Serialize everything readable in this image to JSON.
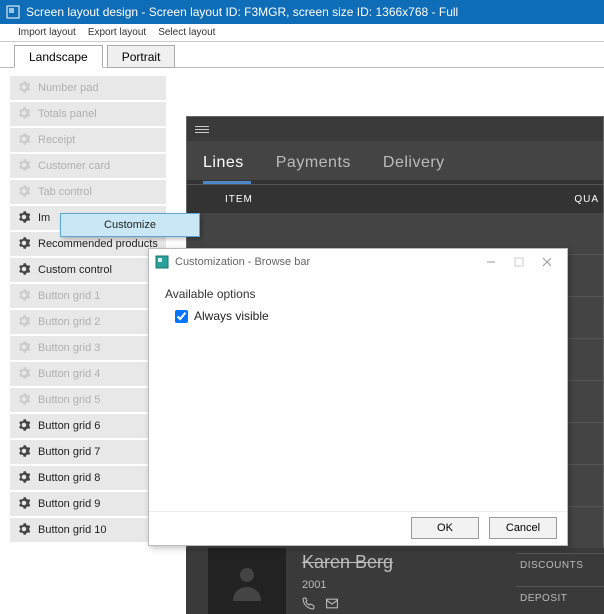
{
  "title": "Screen layout design - Screen layout ID: F3MGR, screen size ID: 1366x768 - Full",
  "menubar": [
    "Import layout",
    "Export layout",
    "Select layout"
  ],
  "tabs": {
    "landscape": "Landscape",
    "portrait": "Portrait"
  },
  "sidebar": {
    "items": [
      {
        "label": "Number pad",
        "enabled": false
      },
      {
        "label": "Totals panel",
        "enabled": false
      },
      {
        "label": "Receipt",
        "enabled": false
      },
      {
        "label": "Customer card",
        "enabled": false
      },
      {
        "label": "Tab control",
        "enabled": false
      },
      {
        "label": "Im",
        "enabled": true
      },
      {
        "label": "Recommended products",
        "enabled": true
      },
      {
        "label": "Custom control",
        "enabled": true
      },
      {
        "label": "Button grid 1",
        "enabled": false
      },
      {
        "label": "Button grid 2",
        "enabled": false
      },
      {
        "label": "Button grid 3",
        "enabled": false
      },
      {
        "label": "Button grid 4",
        "enabled": false
      },
      {
        "label": "Button grid 5",
        "enabled": false
      },
      {
        "label": "Button grid 6",
        "enabled": true
      },
      {
        "label": "Button grid 7",
        "enabled": true
      },
      {
        "label": "Button grid 8",
        "enabled": true
      },
      {
        "label": "Button grid 9",
        "enabled": true
      },
      {
        "label": "Button grid 10",
        "enabled": true
      }
    ]
  },
  "context_menu": {
    "item": "Customize"
  },
  "preview": {
    "tabs": {
      "lines": "Lines",
      "payments": "Payments",
      "delivery": "Delivery"
    },
    "header": {
      "item": "ITEM",
      "quantity": "QUA"
    },
    "user": {
      "name": "Karen Berg",
      "year": "2001"
    },
    "footer": {
      "discounts": "DISCOUNTS",
      "deposit": "DEPOSIT"
    }
  },
  "dialog": {
    "title": "Customization - Browse bar",
    "section_label": "Available options",
    "checkbox_label": "Always visible",
    "ok": "OK",
    "cancel": "Cancel"
  }
}
